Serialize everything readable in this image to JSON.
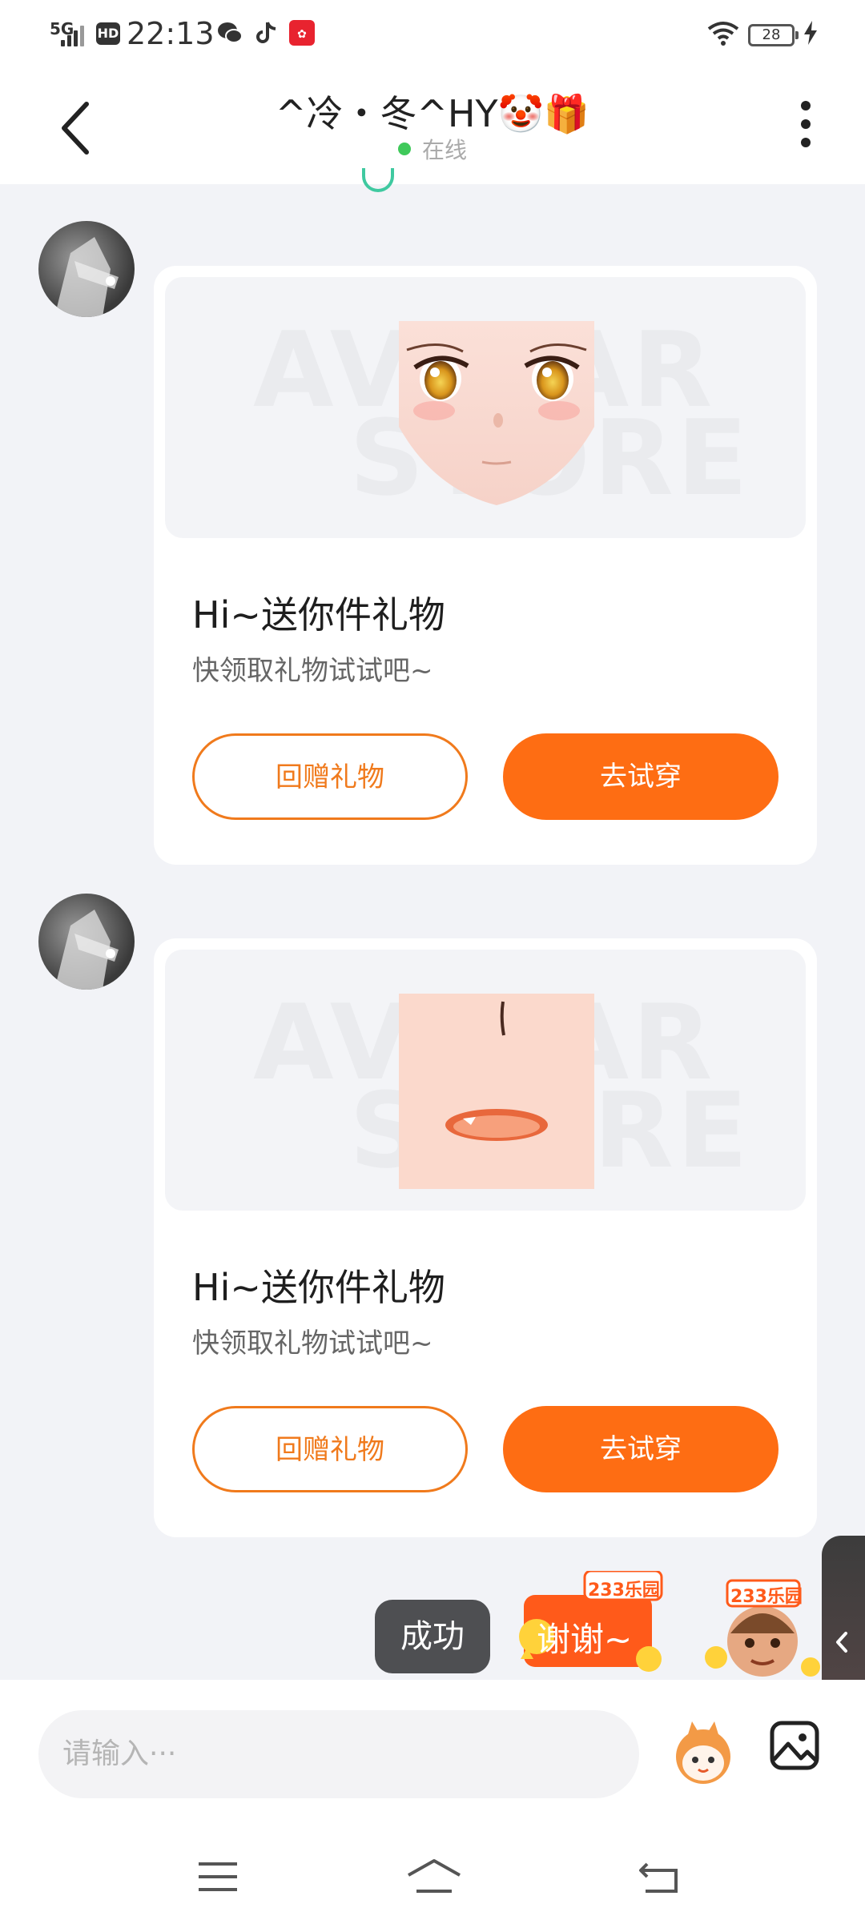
{
  "status_bar": {
    "network": "5G",
    "hd": "HD",
    "time": "22:13",
    "battery": "28"
  },
  "header": {
    "title": "^冷・冬^HY🤡🎁",
    "status": "在线"
  },
  "messages": [
    {
      "title": "Hi~送你件礼物",
      "subtitle": "快领取礼物试试吧~",
      "return_gift_label": "回赠礼物",
      "try_on_label": "去试穿",
      "watermark_top": "AVATAR",
      "watermark_bottom": "STORE",
      "preview_item": "face-eyes"
    },
    {
      "title": "Hi~送你件礼物",
      "subtitle": "快领取礼物试试吧~",
      "return_gift_label": "回赠礼物",
      "try_on_label": "去试穿",
      "watermark_top": "AVATAR",
      "watermark_bottom": "STORE",
      "preview_item": "face-mouth"
    }
  ],
  "toast": "成功",
  "stickers": {
    "thanks_text": "谢谢~",
    "brand_badge": "233乐园"
  },
  "composer": {
    "placeholder": "请输入···"
  },
  "colors": {
    "accent": "#fe6d13",
    "online": "#3fc95a",
    "toast_bg": "#4e4f52"
  }
}
